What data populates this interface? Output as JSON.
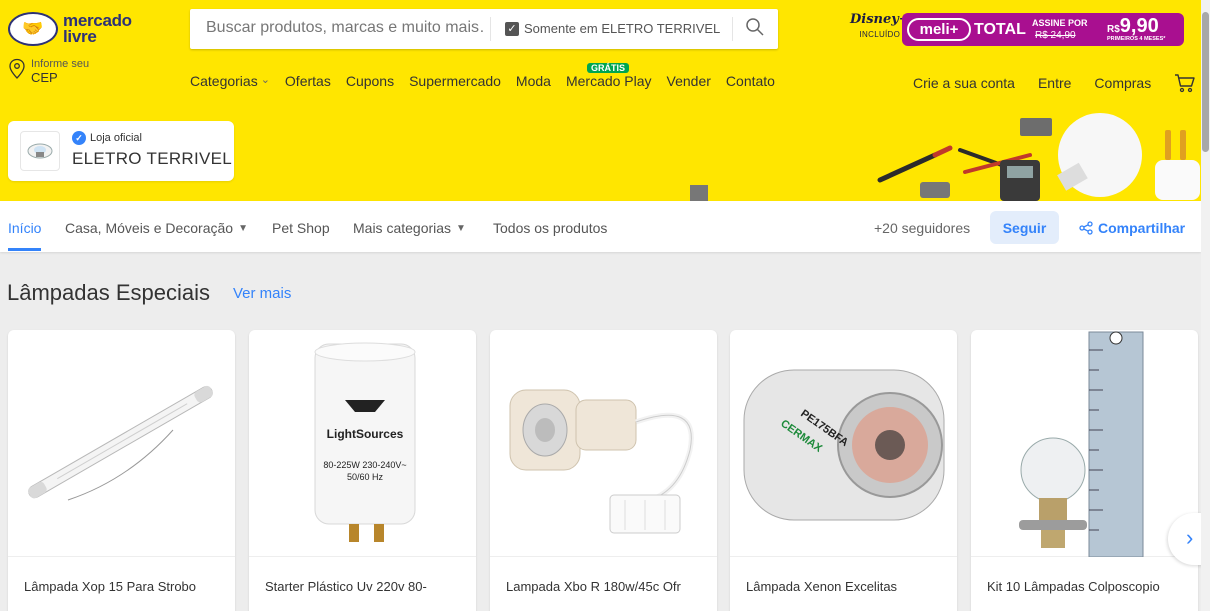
{
  "header": {
    "logo_line1": "mercado",
    "logo_line2": "livre",
    "search": {
      "placeholder": "Buscar produtos, marcas e muito mais…",
      "filter_label": "Somente em ELETRO TERRIVEL",
      "filter_checked": true
    },
    "promo": {
      "disney_logo": "Disney+",
      "disney_sub": "INCLUÍDO",
      "meli_label": "meli+",
      "total_label": "TOTAL",
      "assine_label": "ASSINE POR",
      "old_price": "R$ 24,90",
      "currency": "R$",
      "price": "9,90",
      "months_label": "PRIMEIROS 4 MESES*",
      "brand_color": "#a90f90"
    },
    "cep": {
      "line1": "Informe seu",
      "line2": "CEP"
    },
    "nav": [
      "Categorias",
      "Ofertas",
      "Cupons",
      "Supermercado",
      "Moda",
      "Mercado Play",
      "Vender",
      "Contato"
    ],
    "gratis_badge": "GRÁTIS",
    "right_nav": [
      "Crie a sua conta",
      "Entre",
      "Compras"
    ],
    "accent_color": "#ffe600"
  },
  "store": {
    "official_label": "Loja oficial",
    "name": "ELETRO TERRIVEL"
  },
  "store_nav": {
    "items": [
      "Início",
      "Casa, Móveis e Decoração",
      "Pet Shop",
      "Mais categorias",
      "Todos os produtos"
    ],
    "followers": "+20 seguidores",
    "follow_label": "Seguir",
    "share_label": "Compartilhar",
    "link_color": "#3483fa"
  },
  "section": {
    "title": "Lâmpadas Especiais",
    "see_more": "Ver mais",
    "products": [
      {
        "title": "Lâmpada Xop 15 Para Strobo",
        "icon": "tube-lamp-icon"
      },
      {
        "title": "Starter Plástico Uv 220v 80-",
        "icon": "starter-icon",
        "label_brand": "LightSources",
        "label_specs1": "80-225W 230-240V~",
        "label_specs2": "50/60 Hz"
      },
      {
        "title": "Lampada Xbo R 180w/45c Ofr",
        "icon": "xbo-lamp-icon"
      },
      {
        "title": "Lâmpada Xenon Excelitas",
        "icon": "xenon-lamp-icon",
        "label_model": "PE175BFA",
        "label_brand": "CERMAX"
      },
      {
        "title": "Kit 10 Lâmpadas Colposcopio",
        "icon": "bulb-ruler-icon"
      }
    ]
  }
}
